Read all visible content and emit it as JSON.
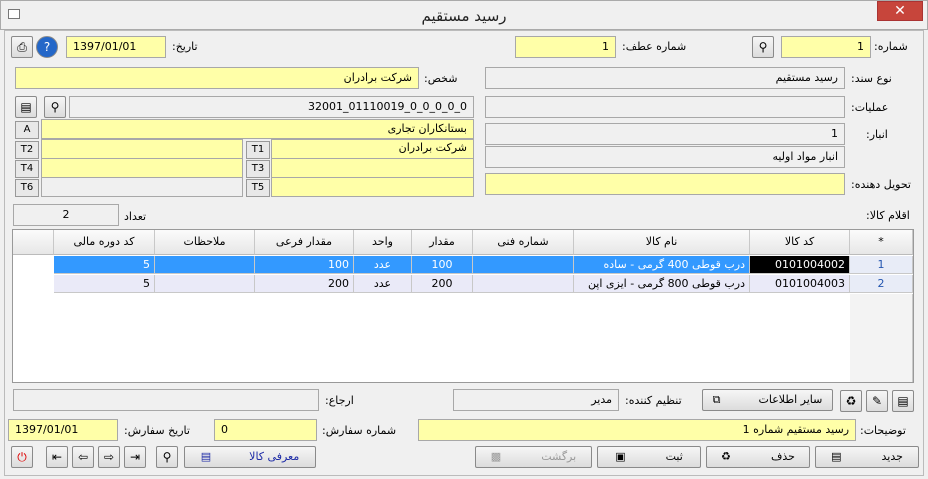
{
  "window": {
    "title": "رسید مستقیم",
    "close": "✕"
  },
  "header": {
    "number_label": "شماره:",
    "number_value": "1",
    "ref_number_label": "شماره عطف:",
    "ref_number_value": "1",
    "date_label": "تاریخ:",
    "date_value": "1397/01/01"
  },
  "form": {
    "doc_type_label": "نوع سند:",
    "doc_type_value": "رسید مستقیم",
    "operation_label": "عملیات:",
    "operation_value": "",
    "warehouse_label": "انبار:",
    "warehouse_code": "1",
    "warehouse_name": "انبار مواد اولیه",
    "deliverer_label": "تحویل دهنده:",
    "deliverer_value": "",
    "person_label": "شخص:",
    "person_value": "شرکت برادران",
    "account_code": "32001_01110019_0_0_0_0_0",
    "a_label": "A",
    "a_value": "بستانکاران تجاری",
    "t1_label": "T1",
    "t1_value": "شرکت برادران",
    "t2_label": "T2",
    "t3_label": "T3",
    "t4_label": "T4",
    "t5_label": "T5",
    "t6_label": "T6"
  },
  "items": {
    "label": "اقلام کالا:",
    "count_label": "تعداد",
    "count_value": "2",
    "columns": [
      "*",
      "کد کالا",
      "نام کالا",
      "شماره فنی",
      "مقدار",
      "واحد",
      "مقدار فرعی",
      "ملاحظات",
      "کد دوره مالی"
    ],
    "rows": [
      {
        "idx": "1",
        "code": "0101004002",
        "name": "درب قوطی 400 گرمی - ساده",
        "tech": "",
        "qty": "100",
        "unit": "عدد",
        "subqty": "100",
        "notes": "",
        "period": "5"
      },
      {
        "idx": "2",
        "code": "0101004003",
        "name": "درب قوطی 800 گرمی - ایزی اپن",
        "tech": "",
        "qty": "200",
        "unit": "عدد",
        "subqty": "200",
        "notes": "",
        "period": "5"
      }
    ]
  },
  "footer": {
    "other_info": "سایر اطلاعات",
    "arranger_label": "تنظیم کننده:",
    "arranger_value": "مدیر",
    "reference_label": "ارجاع:",
    "reference_value": "",
    "description_label": "توضیحات:",
    "description_value": "رسید مستقیم شماره 1",
    "order_number_label": "شماره سفارش:",
    "order_number_value": "0",
    "order_date_label": "تاریخ سفارش:",
    "order_date_value": "1397/01/01",
    "new": "جدید",
    "delete": "حذف",
    "save": "ثبت",
    "back": "برگشت",
    "introduce_item": "معرفی کالا"
  },
  "colors": {
    "highlight": "#3399ff",
    "yellow": "#ffffa8",
    "close": "#c7453b"
  }
}
